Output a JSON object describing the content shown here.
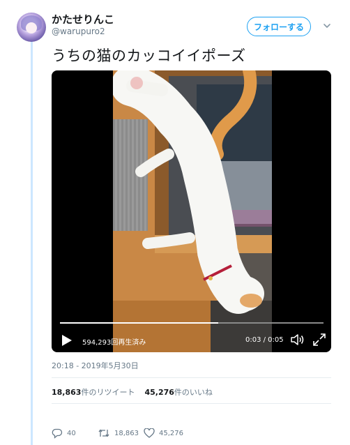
{
  "user": {
    "name": "かたせりんこ",
    "handle": "@warupuro2",
    "follow_label": "フォローする"
  },
  "tweet": {
    "text": "うちの猫のカッコイイポーズ",
    "timestamp": "20:18 - 2019年5月30日"
  },
  "video": {
    "views": "594,293回再生済み",
    "time": "0:03 / 0:05",
    "progress_fraction": 0.6
  },
  "stats": {
    "retweet_count": "18,863",
    "retweet_label": "件のリツイート",
    "like_count": "45,276",
    "like_label": "件のいいね"
  },
  "actions": {
    "reply_count": "40",
    "retweet_count": "18,863",
    "like_count": "45,276"
  },
  "colors": {
    "accent": "#1da1f2",
    "secondary_text": "#657786",
    "thread_line": "#cce7ff"
  }
}
